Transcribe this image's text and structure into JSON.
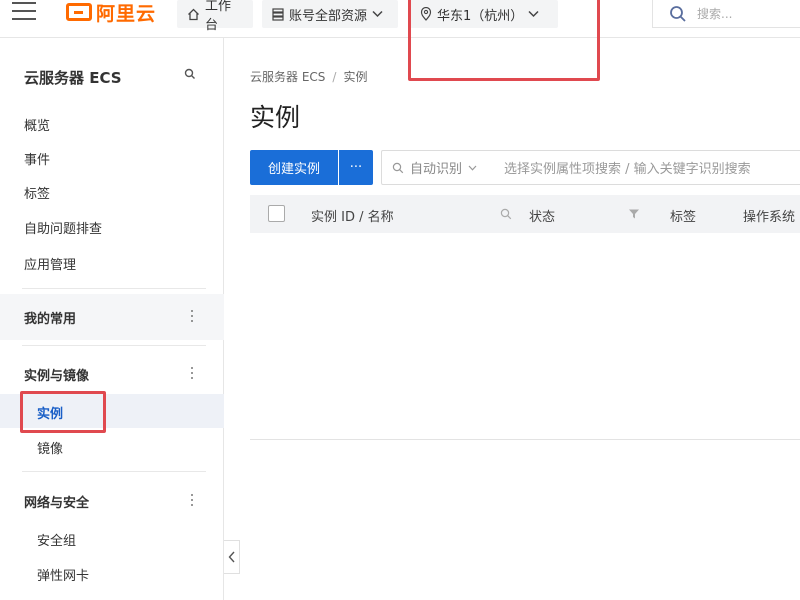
{
  "topbar": {
    "logo_text": "阿里云",
    "workbench_label": "工作台",
    "resources_label": "账号全部资源",
    "region_label": "华东1（杭州）",
    "search_placeholder": "搜索..."
  },
  "sidebar": {
    "title": "云服务器 ECS",
    "top_items": [
      "概览",
      "事件",
      "标签",
      "自助问题排查",
      "应用管理"
    ],
    "group_favorites": "我的常用",
    "group_instances": "实例与镜像",
    "instance_items": [
      "实例",
      "镜像"
    ],
    "group_network": "网络与安全",
    "network_items": [
      "安全组",
      "弹性网卡"
    ]
  },
  "main": {
    "breadcrumb": [
      "云服务器 ECS",
      "实例"
    ],
    "title": "实例",
    "create_button": "创建实例",
    "more_button": "···",
    "filter_key": "自动识别",
    "filter_placeholder": "选择实例属性项搜索 / 输入关键字识别搜索",
    "columns": [
      "实例 ID / 名称",
      "状态",
      "标签",
      "操作系统"
    ]
  },
  "colors": {
    "brand": "#ff6a00",
    "primary": "#1a6ed8",
    "annotation": "#e0494f",
    "active_bg": "#eef1f7"
  }
}
